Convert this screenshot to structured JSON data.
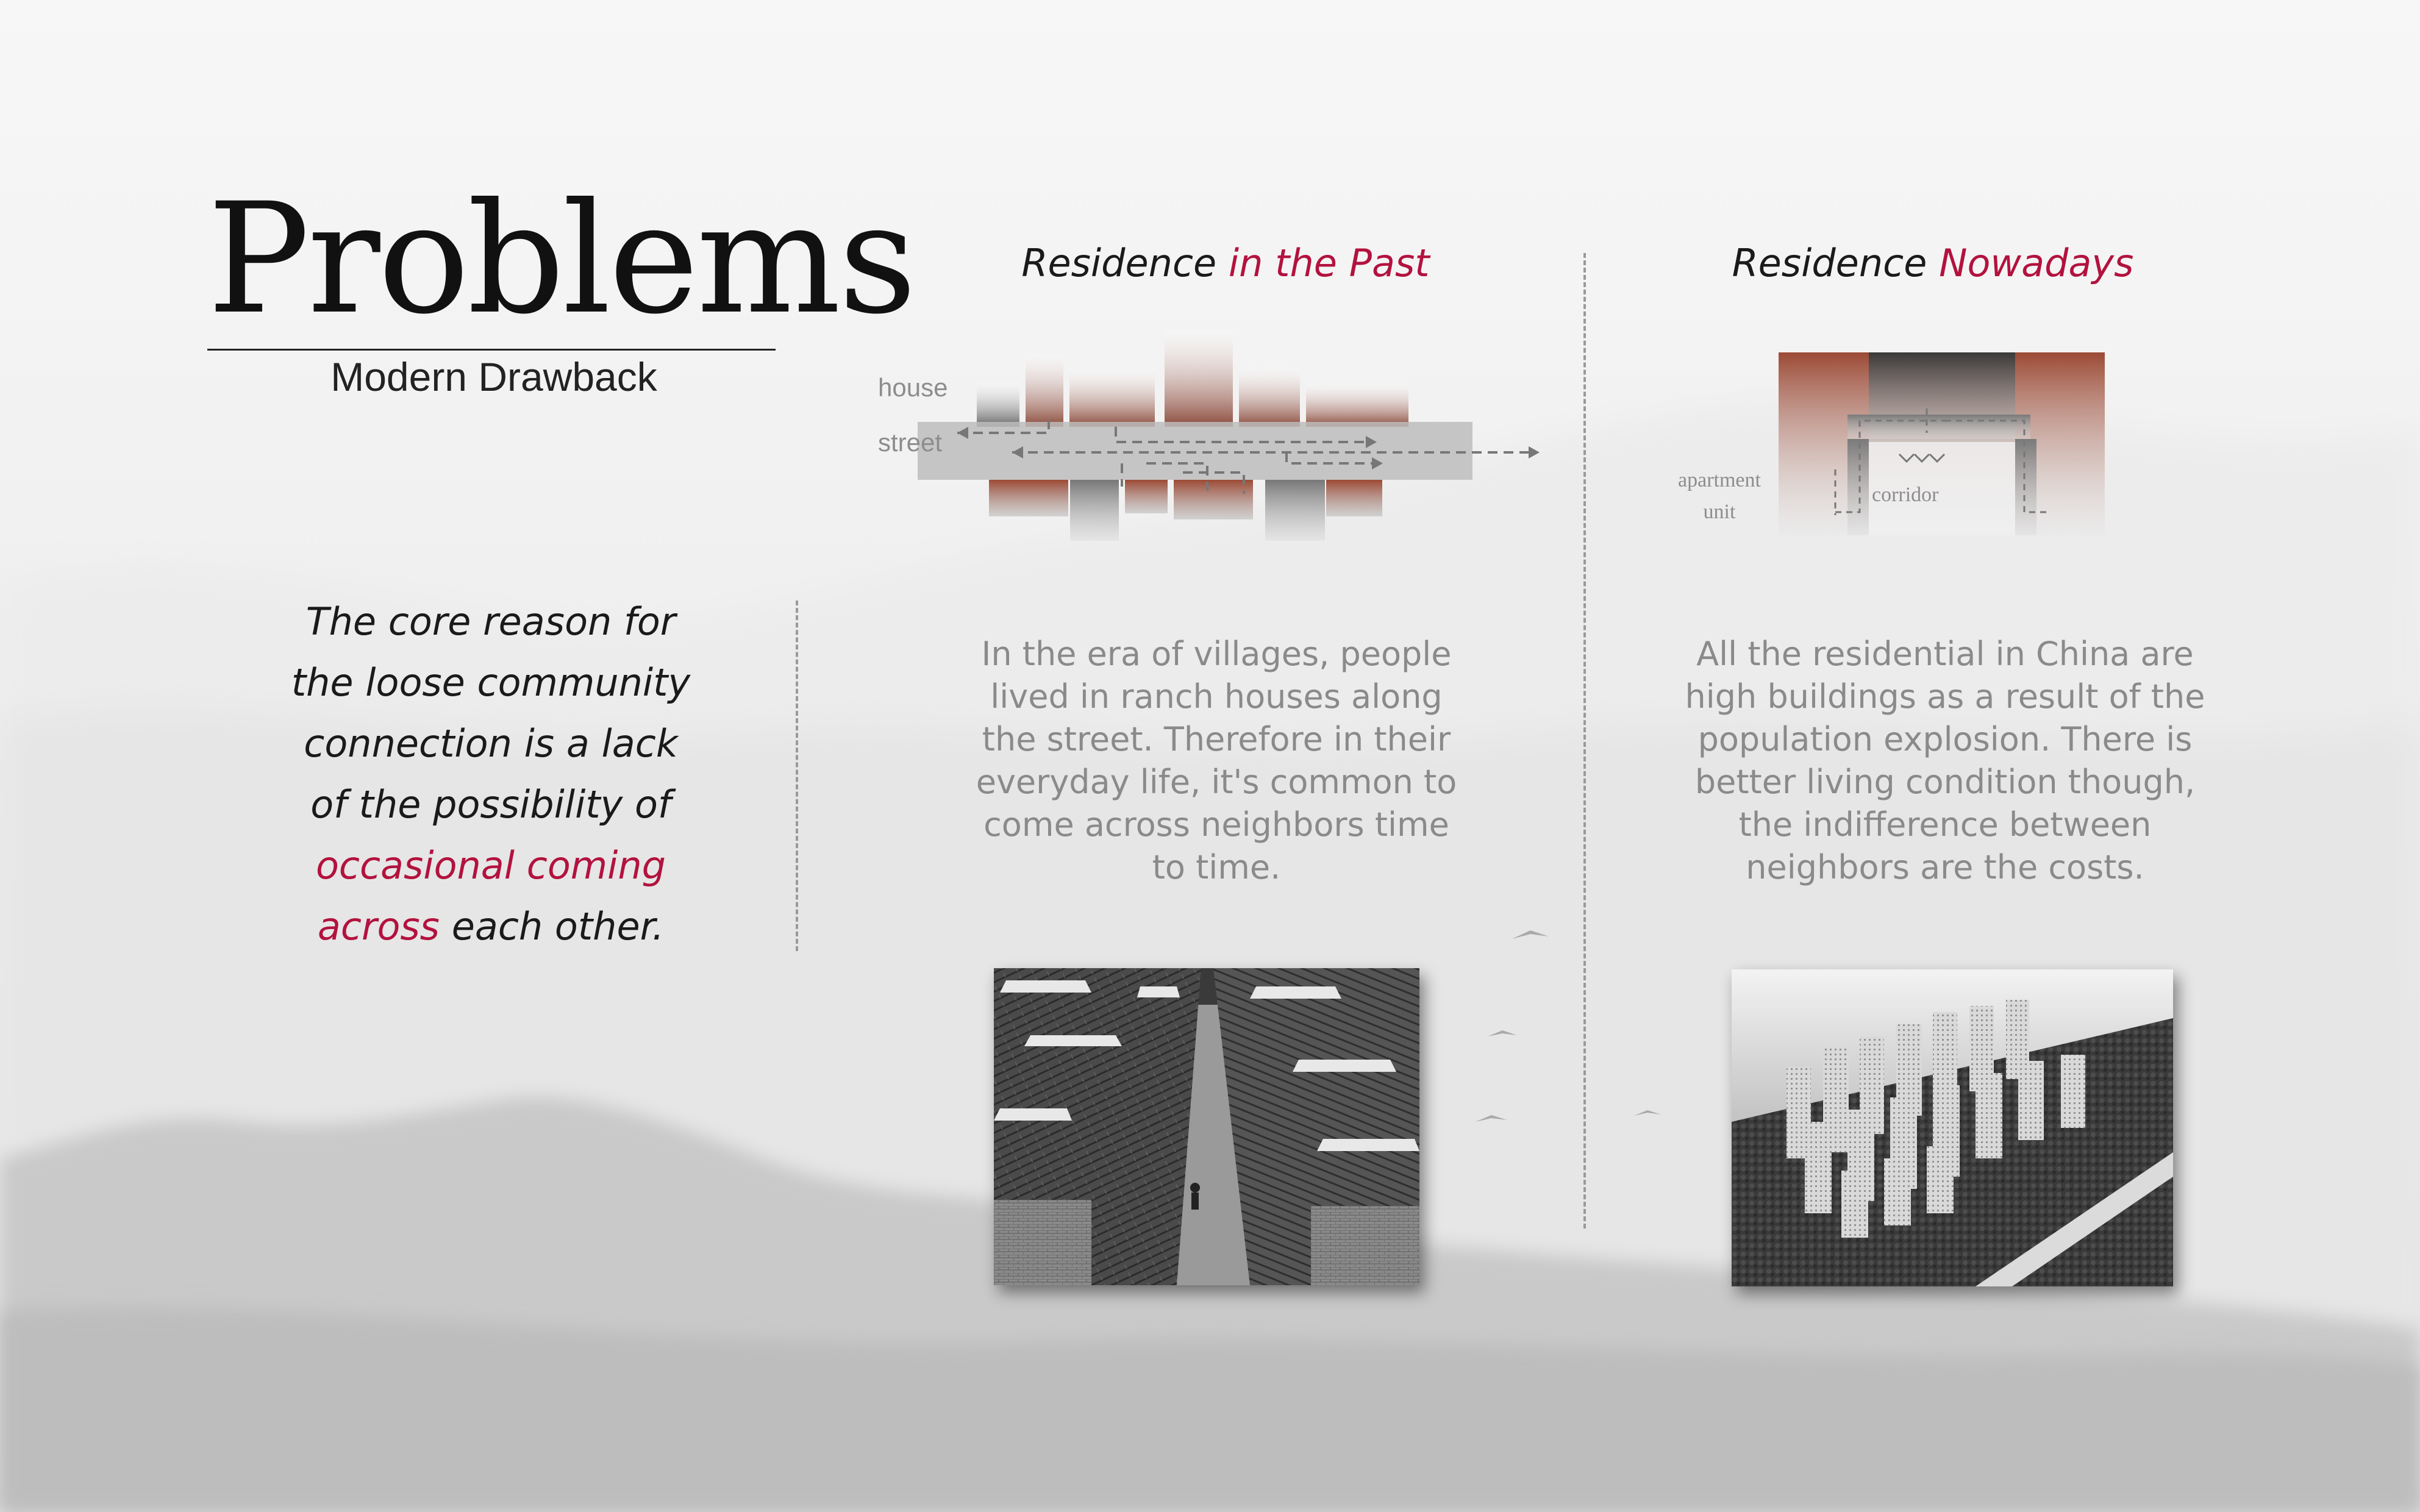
{
  "header": {
    "title": "Problems",
    "subtitle": "Modern Drawback"
  },
  "lead": {
    "line1": "The core reason for",
    "line2": "the loose community",
    "line3": "connection is a lack",
    "line4": "of the possibility of",
    "line5_accent": "occasional coming",
    "line6_accent": "across",
    "line6_rest": " each other."
  },
  "past": {
    "heading_main": "Residence ",
    "heading_accent": "in the Past",
    "diagram": {
      "house_label": "house",
      "street_label": "street"
    },
    "body": [
      "In the era of villages, people",
      "lived in ranch houses along",
      "the street. Therefore in their",
      "everyday life, it's common to",
      "come across neighbors time",
      "to time."
    ]
  },
  "now": {
    "heading_main": "Residence ",
    "heading_accent": "Nowadays",
    "diagram": {
      "unit_label_1": "apartment",
      "unit_label_2": "unit",
      "corridor_label": "corridor"
    },
    "body": [
      "All the residential in China are",
      "high buildings as a result of the",
      "population explosion. There is",
      "better living condition though,",
      "the indifference between",
      "neighbors are the costs."
    ]
  },
  "colors": {
    "accent": "#b3123e",
    "brick": "#9c4a35",
    "text_gray": "#8a8a8a"
  },
  "images": {
    "past_photo": "village-street-photo",
    "now_photo": "high-rise-estate-photo"
  }
}
